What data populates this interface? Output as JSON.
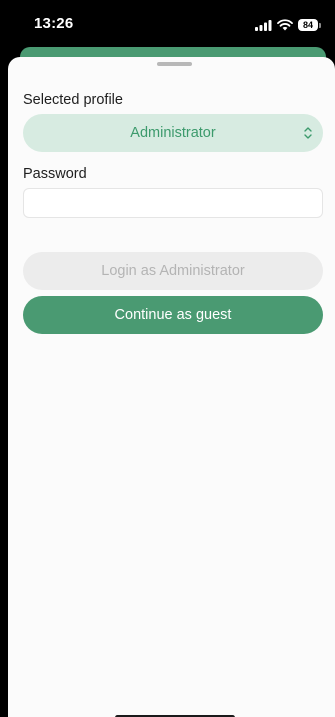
{
  "status_bar": {
    "time": "13:26",
    "battery": "84"
  },
  "sheet": {
    "profile_label": "Selected profile",
    "profile_value": "Administrator",
    "password_label": "Password",
    "password_value": "",
    "login_button": "Login as Administrator",
    "guest_button": "Continue as guest"
  },
  "icons": {
    "signal": "cellular-signal-icon",
    "wifi": "wifi-icon",
    "battery": "battery-icon",
    "select": "chevron-up-down-icon"
  },
  "colors": {
    "accent": "#4a9a72",
    "select_bg": "#d7ebe1",
    "select_text": "#3c9a6c",
    "disabled_bg": "#ececec",
    "disabled_text": "#b4b4b4"
  }
}
